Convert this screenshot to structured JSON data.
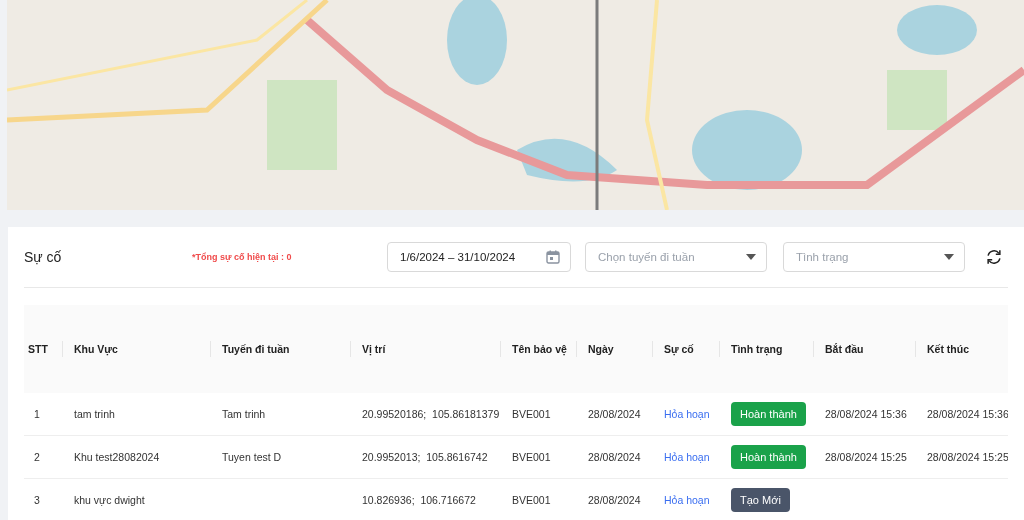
{
  "panel": {
    "title": "Sự cố",
    "total_note": "*Tổng sự cố hiện tại : 0"
  },
  "filters": {
    "date_range": "1/6/2024 – 31/10/2024",
    "route": {
      "placeholder": "Chọn tuyến đi tuần"
    },
    "status": {
      "placeholder": "Tình trạng"
    }
  },
  "table": {
    "columns": [
      "STT",
      "Khu Vực",
      "Tuyến đi tuần",
      "Vị trí",
      "Tên bảo vệ",
      "Ngày",
      "Sự cố",
      "Tình trạng",
      "Bắt đầu",
      "Kết thúc"
    ],
    "rows": [
      {
        "stt": "1",
        "area": "tam trinh",
        "route": "Tam trinh",
        "position": "20.99520186;  105.86181379",
        "guard": "BVE001",
        "date": "28/08/2024",
        "incident": "Hỏa hoạn",
        "status": {
          "label": "Hoàn thành",
          "kind": "done"
        },
        "start": "28/08/2024 15:36",
        "end": "28/08/2024 15:36"
      },
      {
        "stt": "2",
        "area": "Khu test28082024",
        "route": "Tuyen test D",
        "position": "20.9952013;  105.8616742",
        "guard": "BVE001",
        "date": "28/08/2024",
        "incident": "Hỏa hoạn",
        "status": {
          "label": "Hoàn thành",
          "kind": "done"
        },
        "start": "28/08/2024 15:25",
        "end": "28/08/2024 15:25"
      },
      {
        "stt": "3",
        "area": "khu vực dwight",
        "position": "10.826936;  106.716672",
        "guard": "BVE001",
        "date": "28/08/2024",
        "incident": "Hỏa hoạn",
        "status": {
          "label": "Tạo Mới",
          "kind": "new"
        }
      }
    ]
  }
}
